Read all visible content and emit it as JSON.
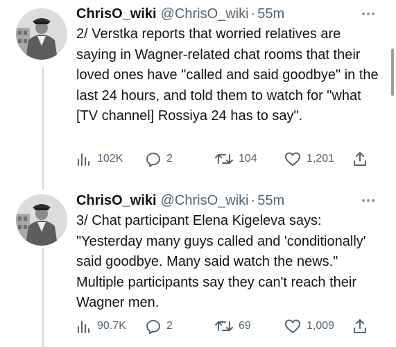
{
  "colors": {
    "text_primary": "#0f1419",
    "text_secondary": "#536471",
    "thread_line": "#cfd9de"
  },
  "tweets": [
    {
      "display_name": "ChrisO_wiki",
      "handle": "@ChrisO_wiki",
      "separator": "·",
      "time": "55m",
      "text": "2/ Verstka reports that worried relatives are saying in Wagner-related chat rooms that their loved ones have \"called and said goodbye\" in the last 24 hours, and told them to watch for \"what [TV channel] Rossiya 24 has to say\".",
      "views": "102K",
      "replies": "2",
      "retweets": "104",
      "likes": "1,201",
      "icons": [
        "views-icon",
        "reply-icon",
        "retweet-icon",
        "like-icon",
        "share-icon"
      ]
    },
    {
      "display_name": "ChrisO_wiki",
      "handle": "@ChrisO_wiki",
      "separator": "·",
      "time": "55m",
      "text": "3/ Chat participant Elena Kigeleva says: \"Yesterday many guys called and 'conditionally' said goodbye. Many said watch the news.\" Multiple participants say they can't reach their Wagner men.",
      "views": "90.7K",
      "replies": "2",
      "retweets": "69",
      "likes": "1,009",
      "icons": [
        "views-icon",
        "reply-icon",
        "retweet-icon",
        "like-icon",
        "share-icon"
      ]
    }
  ]
}
